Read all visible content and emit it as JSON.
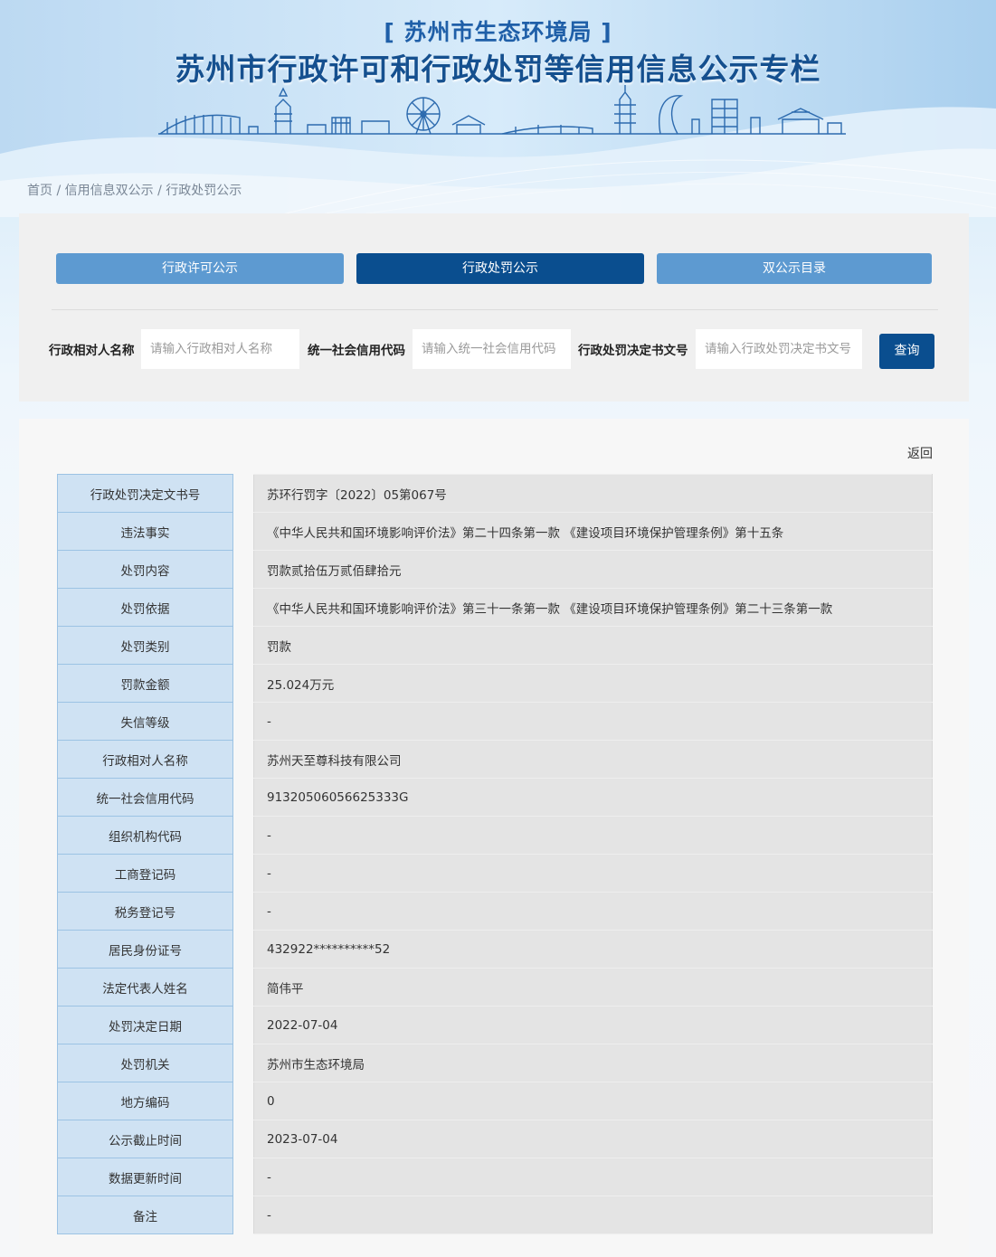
{
  "header": {
    "org": "[ 苏州市生态环境局 ]",
    "title": "苏州市行政许可和行政处罚等信用信息公示专栏"
  },
  "breadcrumb": {
    "items": [
      "首页",
      "信用信息双公示",
      "行政处罚公示"
    ],
    "separator": " / "
  },
  "tabs": [
    {
      "label": "行政许可公示",
      "active": false
    },
    {
      "label": "行政处罚公示",
      "active": true
    },
    {
      "label": "双公示目录",
      "active": false
    }
  ],
  "search": {
    "fields": [
      {
        "label": "行政相对人名称",
        "placeholder": "请输入行政相对人名称",
        "value": ""
      },
      {
        "label": "统一社会信用代码",
        "placeholder": "请输入统一社会信用代码",
        "value": ""
      },
      {
        "label": "行政处罚决定书文号",
        "placeholder": "请输入行政处罚决定书文号",
        "value": ""
      }
    ],
    "button_label": "查询"
  },
  "detail": {
    "back_label": "返回",
    "rows": [
      {
        "label": "行政处罚决定文书号",
        "value": "苏环行罚字〔2022〕05第067号"
      },
      {
        "label": "违法事实",
        "value": "《中华人民共和国环境影响评价法》第二十四条第一款 《建设项目环境保护管理条例》第十五条"
      },
      {
        "label": "处罚内容",
        "value": "罚款贰拾伍万贰佰肆拾元"
      },
      {
        "label": "处罚依据",
        "value": "《中华人民共和国环境影响评价法》第三十一条第一款 《建设项目环境保护管理条例》第二十三条第一款"
      },
      {
        "label": "处罚类别",
        "value": "罚款"
      },
      {
        "label": "罚款金额",
        "value": "25.024万元"
      },
      {
        "label": "失信等级",
        "value": "-"
      },
      {
        "label": "行政相对人名称",
        "value": "苏州天至尊科技有限公司"
      },
      {
        "label": "统一社会信用代码",
        "value": "91320506056625333G"
      },
      {
        "label": "组织机构代码",
        "value": "-"
      },
      {
        "label": "工商登记码",
        "value": "-"
      },
      {
        "label": "税务登记号",
        "value": "-"
      },
      {
        "label": "居民身份证号",
        "value": "432922**********52"
      },
      {
        "label": "法定代表人姓名",
        "value": "简伟平"
      },
      {
        "label": "处罚决定日期",
        "value": "2022-07-04"
      },
      {
        "label": "处罚机关",
        "value": "苏州市生态环境局"
      },
      {
        "label": "地方编码",
        "value": "0"
      },
      {
        "label": "公示截止时间",
        "value": "2023-07-04"
      },
      {
        "label": "数据更新时间",
        "value": "-"
      },
      {
        "label": "备注",
        "value": "-"
      }
    ]
  }
}
